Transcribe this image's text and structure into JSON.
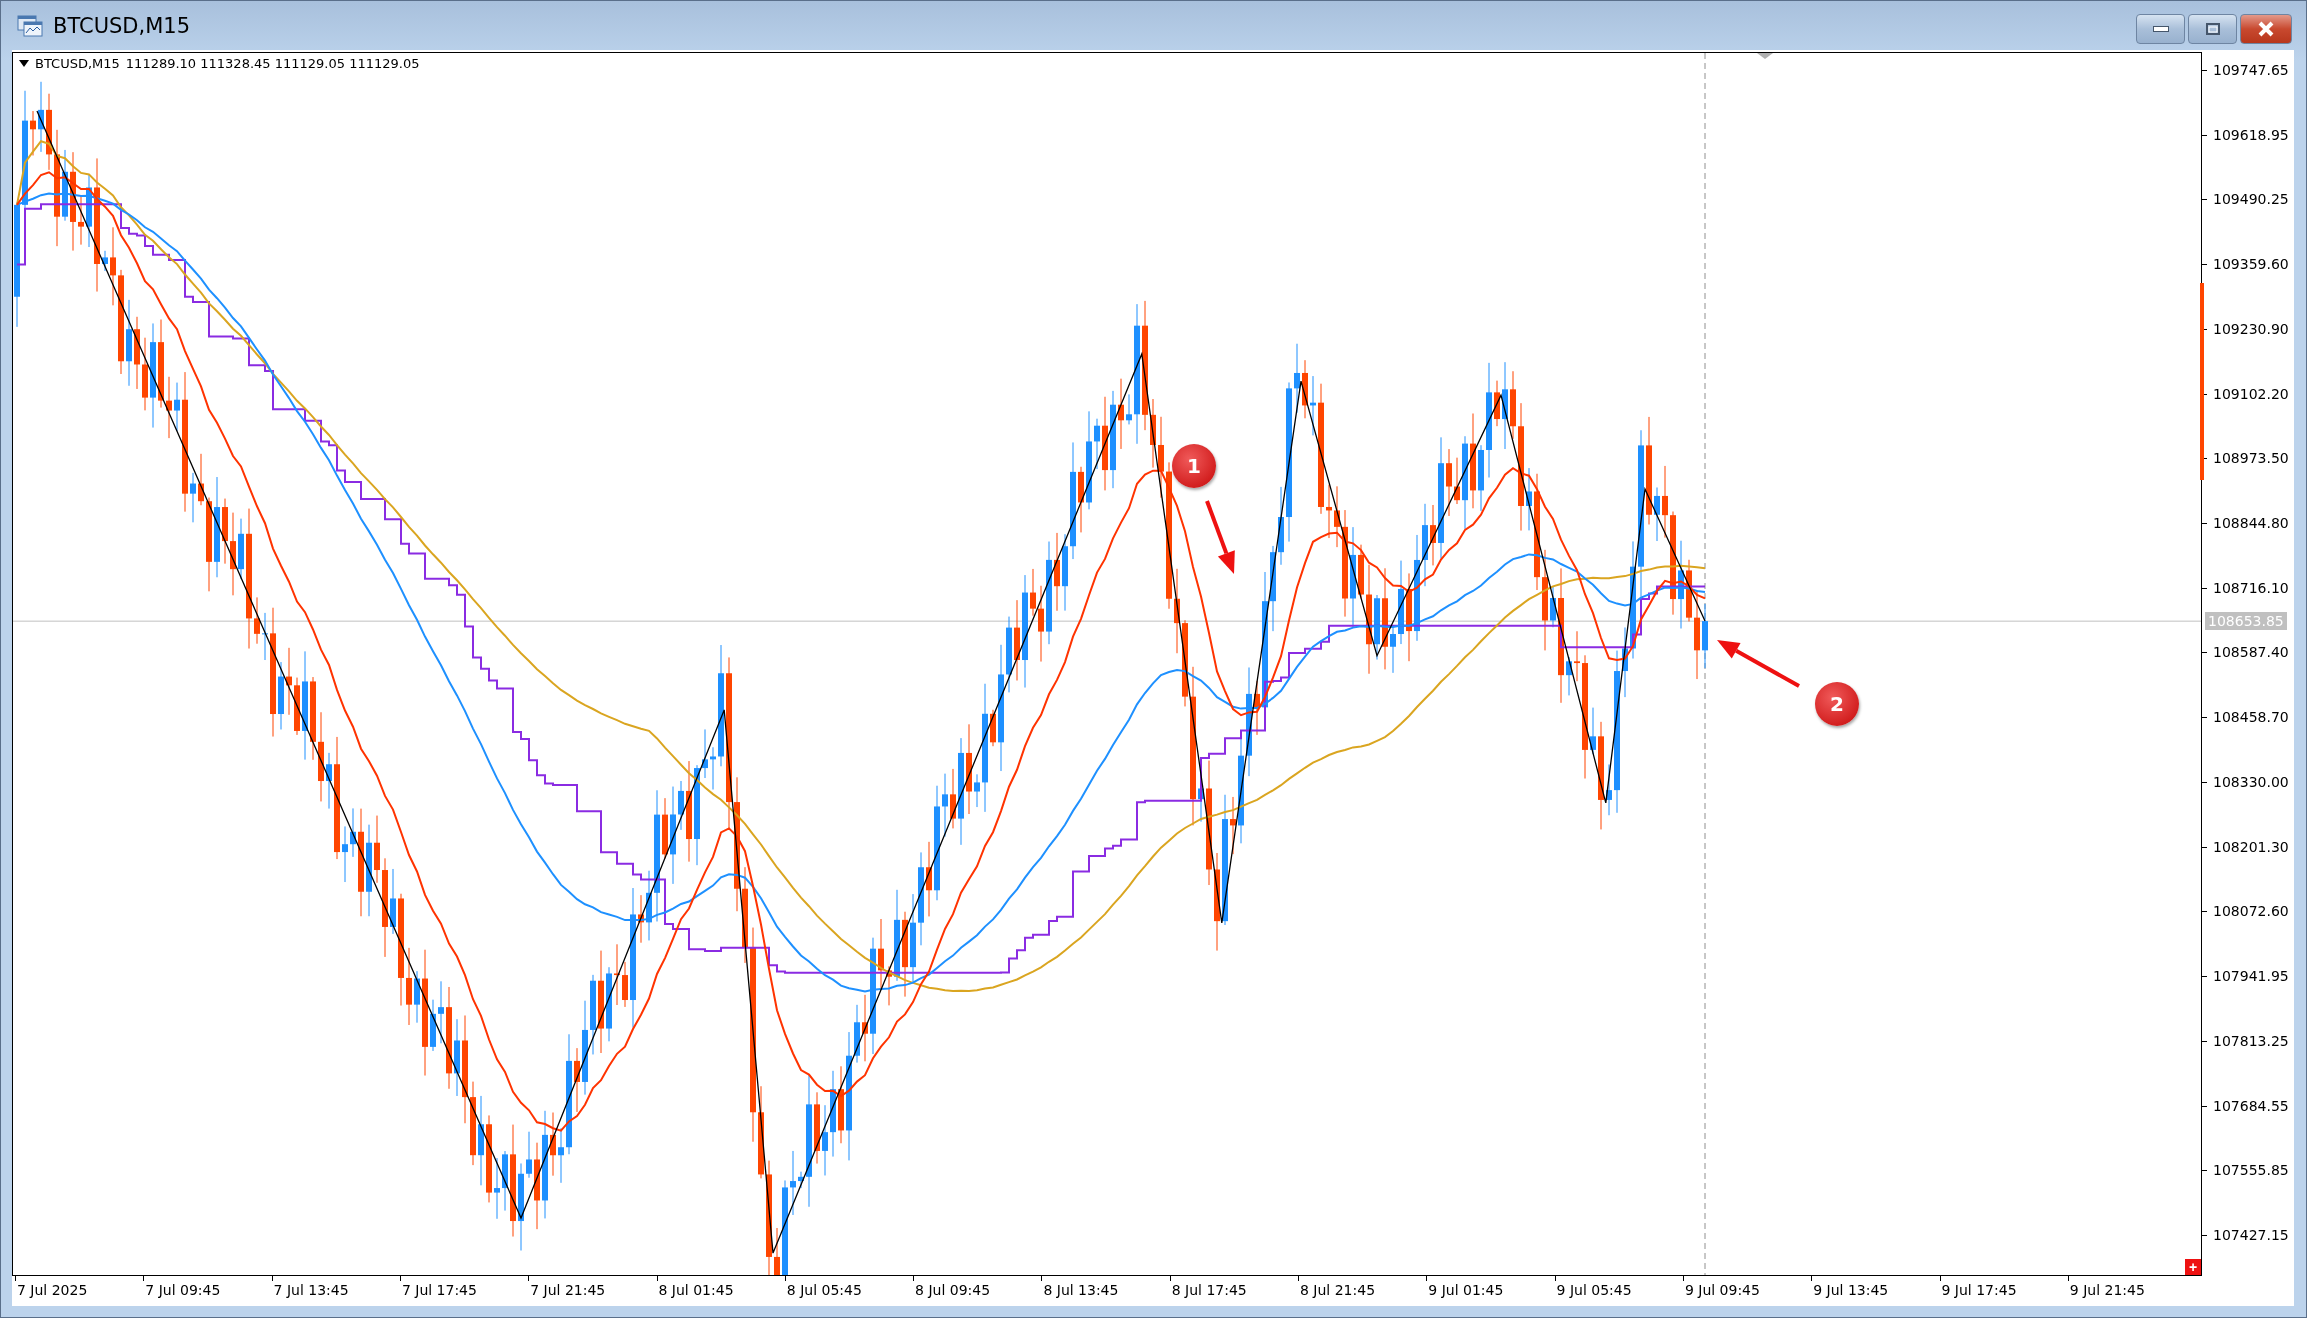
{
  "window": {
    "title": "BTCUSD,M15"
  },
  "chart": {
    "symbol": "BTCUSD,M15",
    "ohlc": "111289.10 111328.45 111129.05 111129.05",
    "price_axis": [
      "109747.65",
      "109618.95",
      "109490.25",
      "109359.60",
      "109230.90",
      "109102.20",
      "108973.50",
      "108844.80",
      "108716.10",
      "108587.40",
      "108458.70",
      "108330.00",
      "108201.30",
      "108072.60",
      "107941.95",
      "107813.25",
      "107684.55",
      "107555.85",
      "107427.15"
    ],
    "current_price": "108653.85",
    "time_axis": [
      "7 Jul 2025",
      "7 Jul 09:45",
      "7 Jul 13:45",
      "7 Jul 17:45",
      "7 Jul 21:45",
      "8 Jul 01:45",
      "8 Jul 05:45",
      "8 Jul 09:45",
      "8 Jul 13:45",
      "8 Jul 17:45",
      "8 Jul 21:45",
      "9 Jul 01:45",
      "9 Jul 05:45",
      "9 Jul 09:45",
      "9 Jul 13:45",
      "9 Jul 17:45",
      "9 Jul 21:45"
    ],
    "markers": [
      {
        "label": "1"
      },
      {
        "label": "2"
      }
    ],
    "corner_button": "+"
  }
}
